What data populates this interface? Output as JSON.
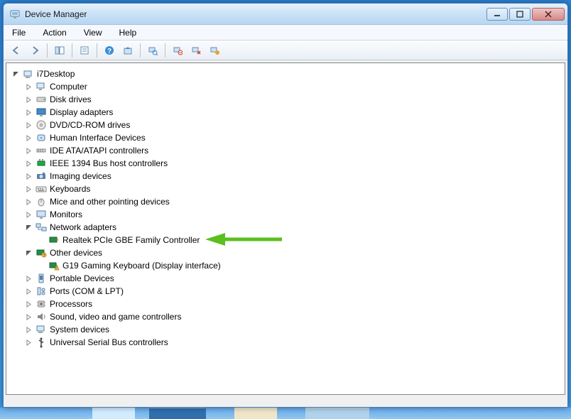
{
  "window": {
    "title": "Device Manager"
  },
  "menu": {
    "file": "File",
    "action": "Action",
    "view": "View",
    "help": "Help"
  },
  "toolbar": {
    "back": "Back",
    "forward": "Forward",
    "show_hide_tree": "Show/Hide Console Tree",
    "properties": "Properties",
    "help": "Help",
    "update": "Update Driver Software",
    "scan": "Scan for hardware changes",
    "uninstall": "Uninstall",
    "disable": "Disable",
    "enable": "Enable"
  },
  "win_controls": {
    "minimize": "Minimize",
    "maximize": "Maximize",
    "close": "Close"
  },
  "tree": {
    "root": "i7Desktop",
    "items": [
      {
        "label": "Computer",
        "icon": "computer",
        "toggle": "closed"
      },
      {
        "label": "Disk drives",
        "icon": "disk",
        "toggle": "closed"
      },
      {
        "label": "Display adapters",
        "icon": "display",
        "toggle": "closed"
      },
      {
        "label": "DVD/CD-ROM drives",
        "icon": "dvd",
        "toggle": "closed"
      },
      {
        "label": "Human Interface Devices",
        "icon": "hid",
        "toggle": "closed"
      },
      {
        "label": "IDE ATA/ATAPI controllers",
        "icon": "ide",
        "toggle": "closed"
      },
      {
        "label": "IEEE 1394 Bus host controllers",
        "icon": "ieee1394",
        "toggle": "closed"
      },
      {
        "label": "Imaging devices",
        "icon": "imaging",
        "toggle": "closed"
      },
      {
        "label": "Keyboards",
        "icon": "keyboard",
        "toggle": "closed"
      },
      {
        "label": "Mice and other pointing devices",
        "icon": "mouse",
        "toggle": "closed"
      },
      {
        "label": "Monitors",
        "icon": "monitor",
        "toggle": "closed"
      },
      {
        "label": "Network adapters",
        "icon": "network",
        "toggle": "open",
        "children": [
          {
            "label": "Realtek PCIe GBE Family Controller",
            "icon": "nic",
            "highlight": true
          }
        ]
      },
      {
        "label": "Other devices",
        "icon": "other",
        "toggle": "open",
        "children": [
          {
            "label": "G19 Gaming Keyboard (Display interface)",
            "icon": "warning"
          }
        ]
      },
      {
        "label": "Portable Devices",
        "icon": "portable",
        "toggle": "closed"
      },
      {
        "label": "Ports (COM & LPT)",
        "icon": "ports",
        "toggle": "closed"
      },
      {
        "label": "Processors",
        "icon": "cpu",
        "toggle": "closed"
      },
      {
        "label": "Sound, video and game controllers",
        "icon": "sound",
        "toggle": "closed"
      },
      {
        "label": "System devices",
        "icon": "system",
        "toggle": "closed"
      },
      {
        "label": "Universal Serial Bus controllers",
        "icon": "usb",
        "toggle": "closed"
      }
    ]
  },
  "annotation": {
    "color": "#5bbf1e"
  }
}
